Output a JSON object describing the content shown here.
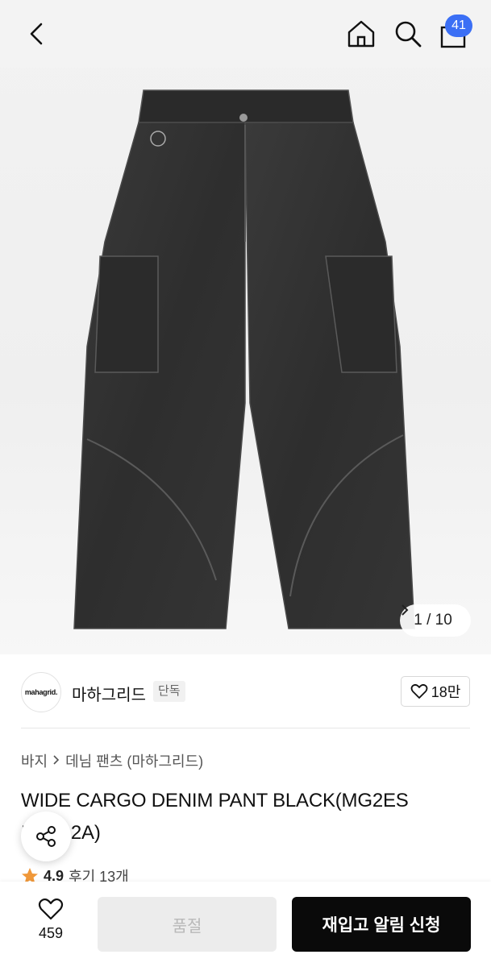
{
  "header": {
    "cart_count": "41",
    "icons": [
      "back-arrow-icon",
      "home-icon",
      "search-icon",
      "shopping-bag-icon"
    ]
  },
  "gallery": {
    "current": "1",
    "total": "10",
    "counter_text": "1 / 10"
  },
  "brand": {
    "logo_text": "mahagrid.",
    "name": "마하그리드",
    "tag": "단독",
    "like_count": "18만"
  },
  "breadcrumb": {
    "level1": "바지",
    "level2": "데님 팬츠 (마하그리드)"
  },
  "product": {
    "title": "WIDE CARGO DENIM PANT BLACK(MG2ES MP512A)"
  },
  "rating": {
    "score": "4.9",
    "reviews": "후기 13개"
  },
  "bottom": {
    "wish_count": "459",
    "soldout_label": "품절",
    "restock_label": "재입고 알림 신청"
  },
  "colors": {
    "badge": "#3b6ff5",
    "primary_button": "#0a0a0a",
    "disabled_button": "#ececec",
    "star": "#f0983a"
  }
}
